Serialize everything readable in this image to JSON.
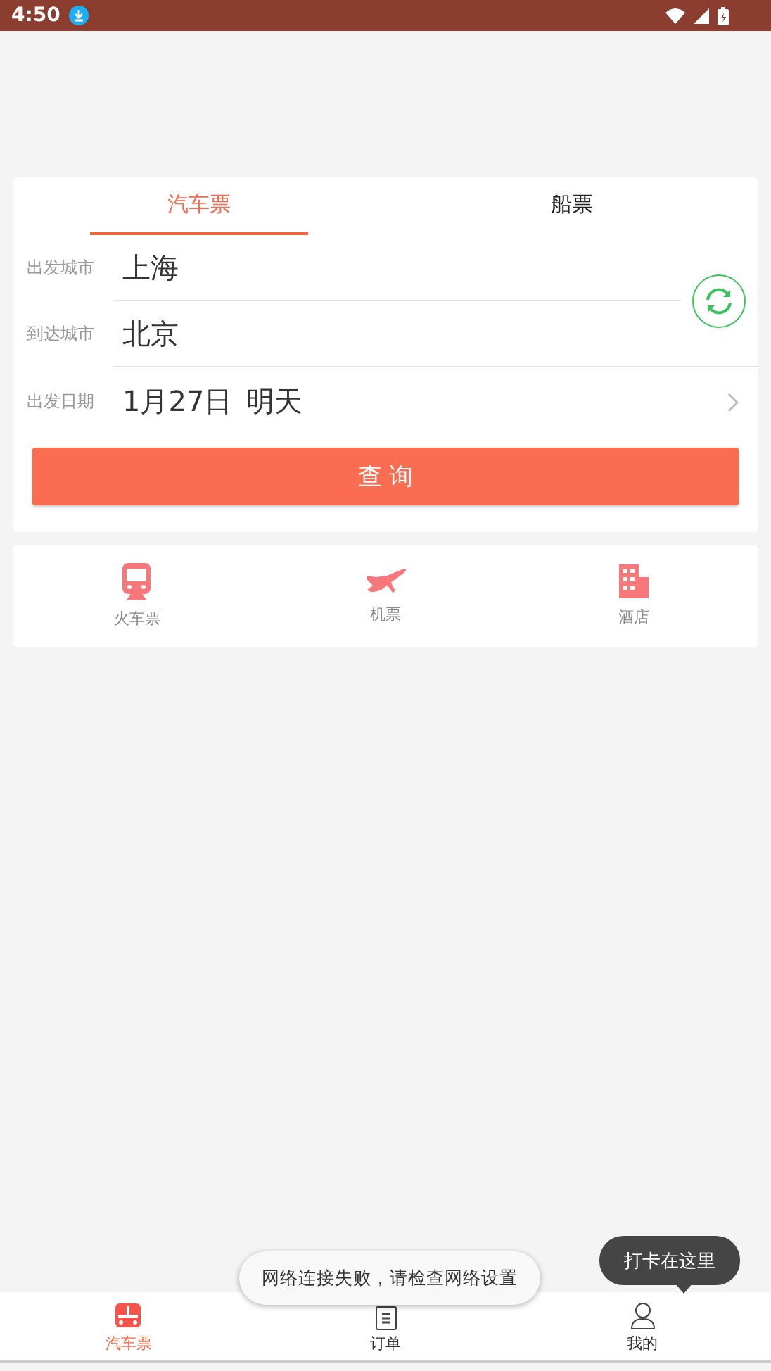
{
  "status_bar": {
    "time": "4:50"
  },
  "tabs": [
    {
      "label": "汽车票",
      "selected": true
    },
    {
      "label": "船票",
      "selected": false
    }
  ],
  "form": {
    "cities": [
      {
        "label": "出发城市",
        "value": "上海"
      },
      {
        "label": "到达城市",
        "value": "北京"
      }
    ],
    "date": {
      "label": "出发日期",
      "value": "1月27日",
      "day": "明天"
    },
    "search_button": "查 询"
  },
  "services": [
    {
      "label": "火车票",
      "kind": "train"
    },
    {
      "label": "机票",
      "kind": "plane"
    },
    {
      "label": "酒店",
      "kind": "hotel"
    }
  ],
  "toast": "网络连接失败，请检查网络设置",
  "tooltip": "打卡在这里",
  "nav": [
    {
      "label": "汽车票",
      "kind": "bus",
      "selected": true
    },
    {
      "label": "订单",
      "kind": "order",
      "selected": false
    },
    {
      "label": "我的",
      "kind": "user",
      "selected": false
    }
  ]
}
